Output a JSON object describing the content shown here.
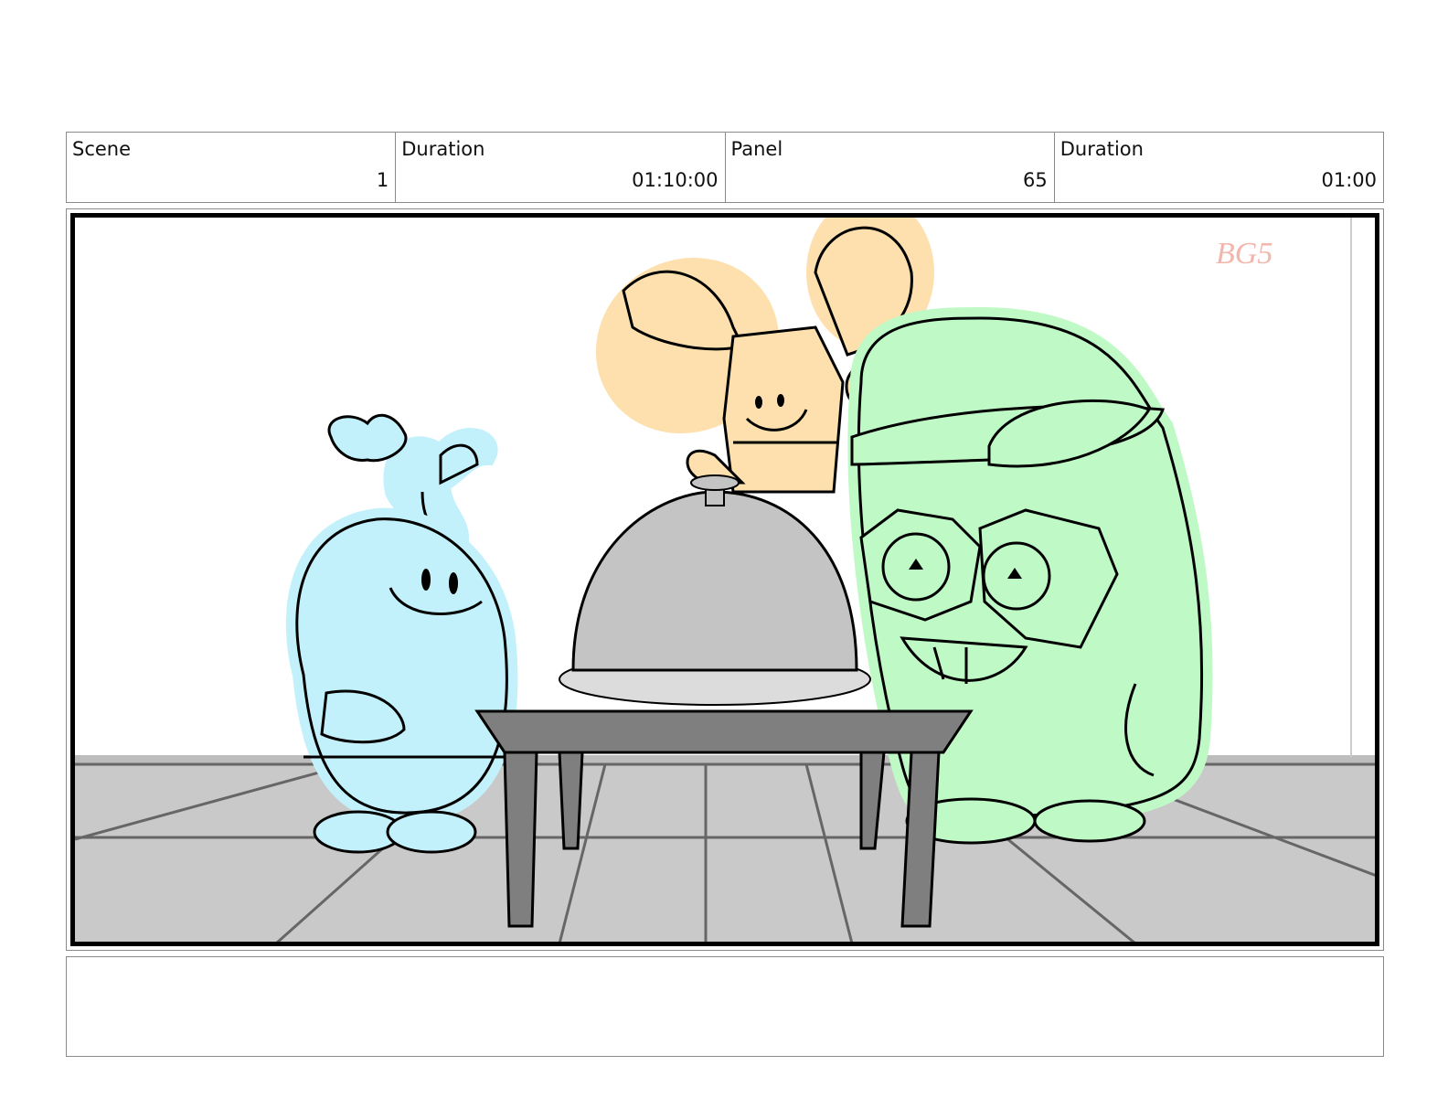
{
  "header": {
    "scene_label": "Scene",
    "scene_value": "1",
    "scene_duration_label": "Duration",
    "scene_duration_value": "01:10:00",
    "panel_label": "Panel",
    "panel_value": "65",
    "panel_duration_label": "Duration",
    "panel_duration_value": "01:00"
  },
  "panel": {
    "initials": "BG5"
  },
  "colors": {
    "blue_character": "#c3f1fb",
    "yellow_character": "#fde0ae",
    "green_character": "#bff9c5",
    "floor": "#c9c9c9",
    "table": "#7f7f7f",
    "cloche": "#c4c4c4",
    "initials": "#f2b6ac"
  },
  "notes": {
    "text": ""
  }
}
